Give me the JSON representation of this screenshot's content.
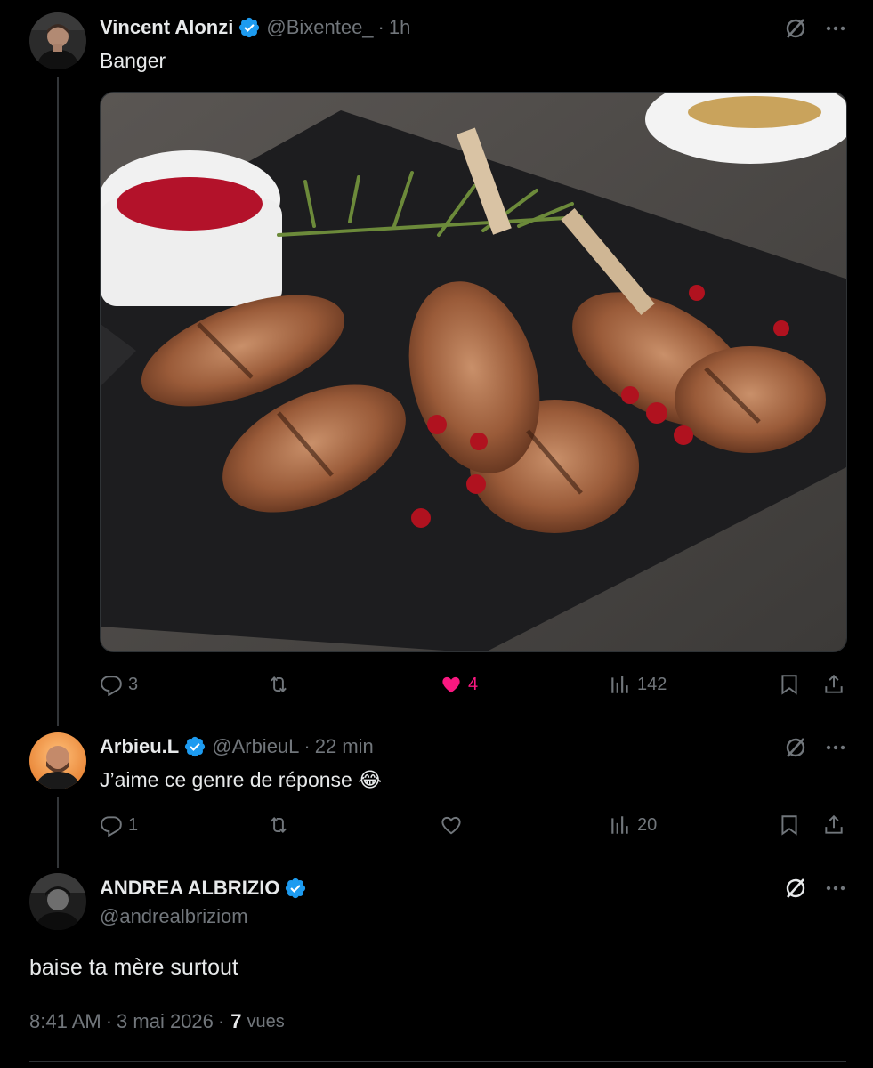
{
  "tweets": [
    {
      "name": "Vincent Alonzi",
      "handle": "@Bixentee_",
      "time": "1h",
      "text": "Banger",
      "replies": "3",
      "retweets": "",
      "likes": "4",
      "views": "142",
      "liked": true
    },
    {
      "name": "Arbieu.L",
      "handle": "@ArbieuL",
      "time": "22 min",
      "text": "J’aime ce genre de réponse 😂",
      "replies": "1",
      "retweets": "",
      "likes": "",
      "views": "20",
      "liked": false
    }
  ],
  "main": {
    "name": "ANDREA ALBRIZIO",
    "handle": "@andrealbriziom",
    "text": "baise ta mère surtout",
    "time": "8:41 AM",
    "date": "3 mai 2026",
    "views_count": "7",
    "views_label": "vues"
  },
  "colors": {
    "background": "#000000",
    "text": "#e7e9ea",
    "muted": "#71767b",
    "verified": "#1d9bf0",
    "like": "#f91880"
  },
  "icons": {
    "verified": "verified-badge-icon",
    "grok": "grok-icon",
    "more": "more-icon",
    "reply": "reply-icon",
    "retweet": "retweet-icon",
    "like": "heart-icon",
    "views": "views-icon",
    "bookmark": "bookmark-icon",
    "share": "share-icon"
  }
}
